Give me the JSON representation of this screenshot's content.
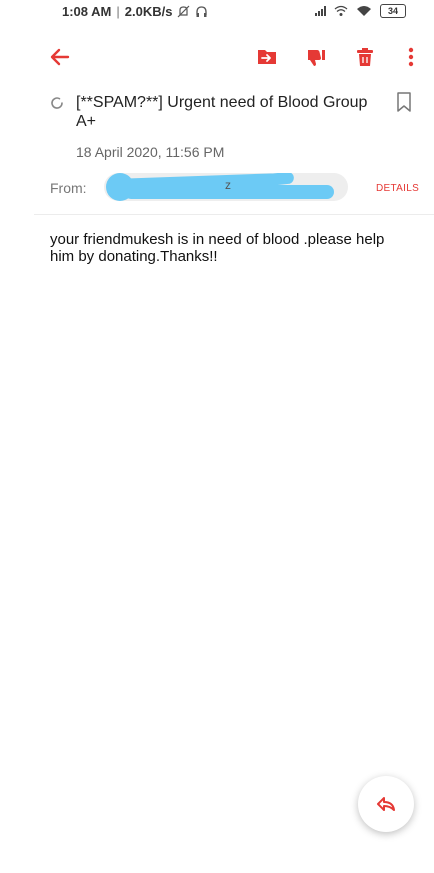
{
  "status_bar": {
    "time": "1:08 AM",
    "separator": "|",
    "speed": "2.0KB/s",
    "battery": "34"
  },
  "toolbar": {
    "back_icon": "arrow-left-icon",
    "move_icon": "move-to-folder-icon",
    "not_spam_icon": "thumbs-down-icon",
    "delete_icon": "trash-icon",
    "more_icon": "more-vertical-icon",
    "accent_color": "#e53935"
  },
  "email": {
    "subject": "[**SPAM?**]  Urgent need of Blood Group A+",
    "date": "18 April 2020, 11:56 PM",
    "from_label": "From:",
    "from_value_visible": "z",
    "details_label": "DETAILS",
    "body": "your friendmukesh is in need of blood .please help him by donating.Thanks!!"
  },
  "fab": {
    "icon": "reply-icon"
  }
}
